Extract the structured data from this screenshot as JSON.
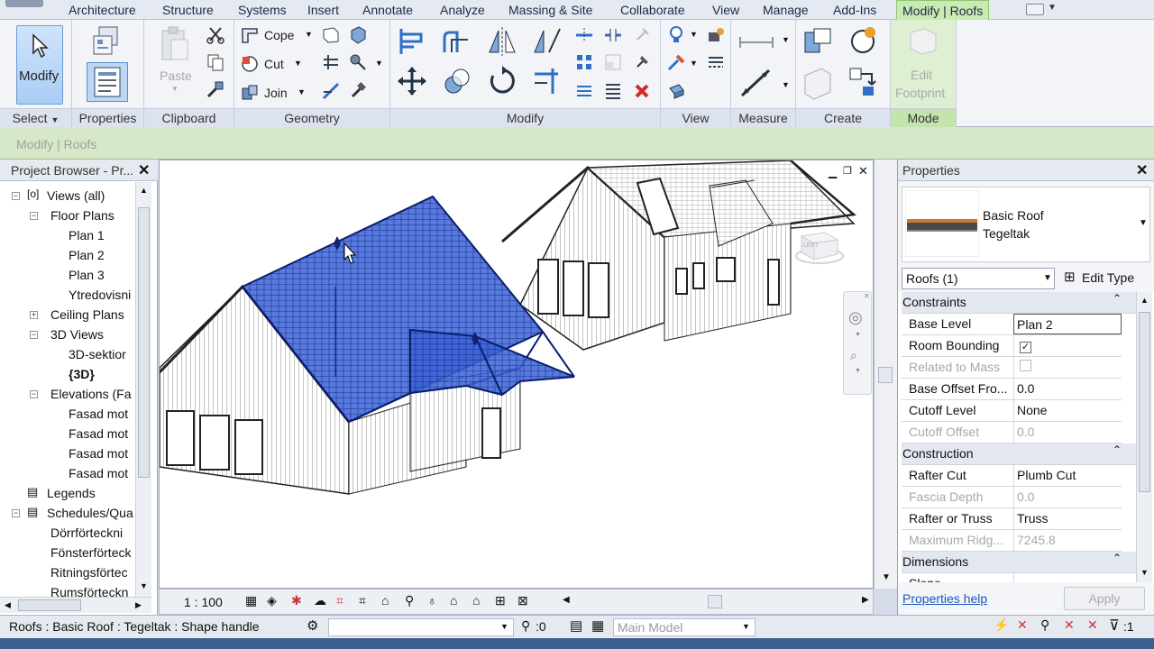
{
  "ribbon": {
    "tabs": [
      "Architecture",
      "Structure",
      "Systems",
      "Insert",
      "Annotate",
      "Analyze",
      "Massing & Site",
      "Collaborate",
      "View",
      "Manage",
      "Add-Ins",
      "Modify | Roofs"
    ],
    "modify_label": "Modify",
    "panels": {
      "select": "Select",
      "properties": "Properties",
      "clipboard": "Clipboard",
      "geometry": "Geometry",
      "modify": "Modify",
      "view": "View",
      "measure": "Measure",
      "create": "Create",
      "mode": "Mode"
    },
    "paste_label": "Paste",
    "cope_label": "Cope",
    "cut_label": "Cut",
    "join_label": "Join",
    "edit_footprint_1": "Edit",
    "edit_footprint_2": "Footprint"
  },
  "context_label": "Modify | Roofs",
  "project_browser": {
    "title": "Project Browser - Pr...",
    "items": [
      {
        "label": "Views (all)"
      },
      {
        "label": "Floor Plans"
      },
      {
        "label": "Plan 1"
      },
      {
        "label": "Plan 2"
      },
      {
        "label": "Plan 3"
      },
      {
        "label": "Ytredovisni"
      },
      {
        "label": "Ceiling Plans"
      },
      {
        "label": "3D Views"
      },
      {
        "label": "3D-sektior"
      },
      {
        "label": "{3D}"
      },
      {
        "label": "Elevations (Fa"
      },
      {
        "label": "Fasad mot"
      },
      {
        "label": "Fasad mot"
      },
      {
        "label": "Fasad mot"
      },
      {
        "label": "Fasad mot"
      },
      {
        "label": "Legends"
      },
      {
        "label": "Schedules/Qua"
      },
      {
        "label": "Dörrförteckni"
      },
      {
        "label": "Fönsterförteck"
      },
      {
        "label": "Ritningsförtec"
      },
      {
        "label": "Rumsförteckn"
      }
    ]
  },
  "view": {
    "scale": "1 : 100",
    "cube_label": "LEFT"
  },
  "properties": {
    "title": "Properties",
    "family": "Basic Roof",
    "type": "Tegeltak",
    "selector": "Roofs (1)",
    "edit_type": "Edit Type",
    "groups": {
      "constraints": "Constraints",
      "construction": "Construction",
      "dimensions": "Dimensions"
    },
    "rows": [
      {
        "key": "Base Level",
        "value": "Plan 2"
      },
      {
        "key": "Room Bounding",
        "value": "✓"
      },
      {
        "key": "Related to Mass",
        "value": ""
      },
      {
        "key": "Base Offset Fro...",
        "value": "0.0"
      },
      {
        "key": "Cutoff Level",
        "value": "None"
      },
      {
        "key": "Cutoff Offset",
        "value": "0.0"
      },
      {
        "key": "Rafter Cut",
        "value": "Plumb Cut"
      },
      {
        "key": "Fascia Depth",
        "value": "0.0"
      },
      {
        "key": "Rafter or Truss",
        "value": "Truss"
      },
      {
        "key": "Maximum Ridg...",
        "value": "7245.8"
      },
      {
        "key": "Slope",
        "value": ""
      }
    ],
    "help": "Properties help",
    "apply": "Apply"
  },
  "status": {
    "text": "Roofs : Basic Roof : Tegeltak : Shape handle",
    "count": ":0",
    "model": "Main Model",
    "filter": ":1"
  }
}
